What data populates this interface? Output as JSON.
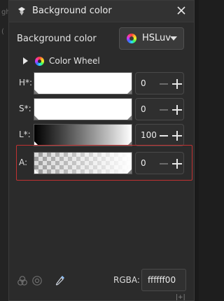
{
  "window": {
    "title": "Background color",
    "close_icon": "close-icon"
  },
  "header": {
    "label": "Background color",
    "mode_value": "HSLuv",
    "mode_icon": "color-wheel-icon"
  },
  "color_wheel": {
    "label": "Color Wheel",
    "expanded": false
  },
  "channels": [
    {
      "label": "H*:",
      "value": "0"
    },
    {
      "label": "S*:",
      "value": "0"
    },
    {
      "label": "L*:",
      "value": "100"
    },
    {
      "label": "A:",
      "value": "0"
    }
  ],
  "footer": {
    "rgba_label": "RGBA:",
    "rgba_value": "ffffff00"
  },
  "background_fragments": [
    "ght",
    "("
  ],
  "colors": {
    "highlight": "#c13232",
    "dialog_bg": "#2b2b2b"
  }
}
